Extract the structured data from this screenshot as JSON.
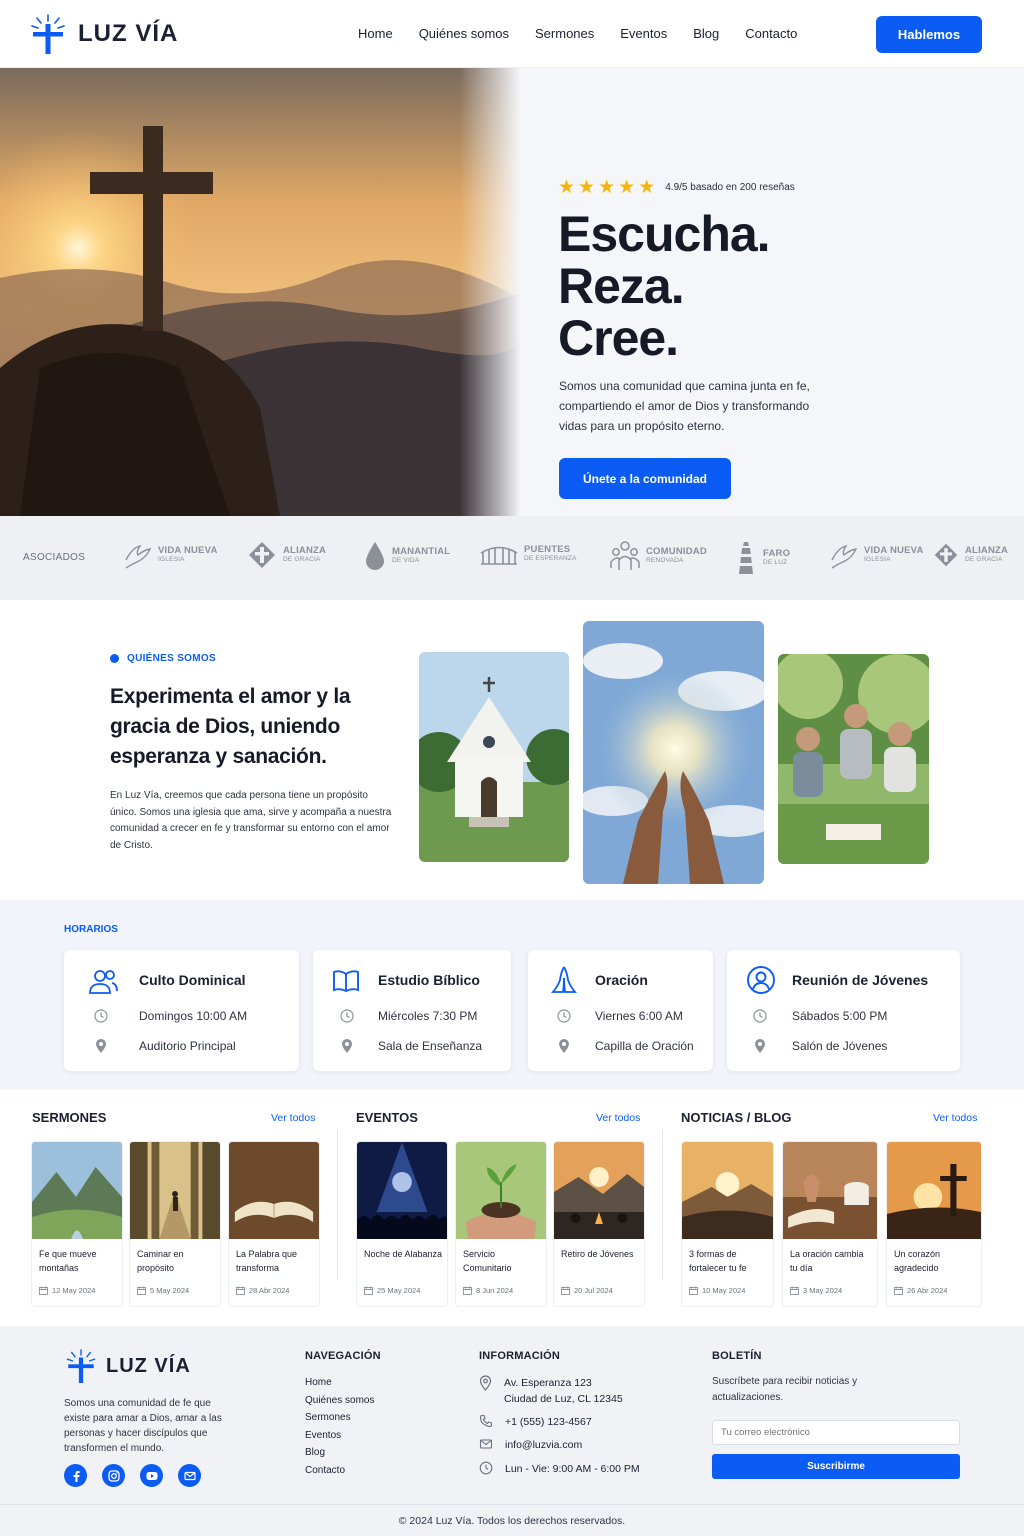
{
  "brand": {
    "name": "LUZ VÍA",
    "accent": "#0b5cf5"
  },
  "nav": {
    "items": [
      "Home",
      "Quiénes somos",
      "Sermones",
      "Eventos",
      "Blog",
      "Contacto"
    ],
    "cta": "Hablemos"
  },
  "hero": {
    "rating_stars": 5,
    "rating_text": "4.9/5 basado en 200 reseñas",
    "headline": [
      "Escucha.",
      "Reza.",
      "Cree."
    ],
    "text": "Somos una comunidad que camina junta en fe, compartiendo el amor de Dios y transformando vidas para un propósito eterno.",
    "cta": "Únete a la comunidad",
    "image_icon": "cross-on-mountain-sunset"
  },
  "partners": {
    "label": "ASOCIADOS",
    "items": [
      {
        "name": "VIDA NUEVA",
        "sub": "IGLESIA",
        "icon": "dove-icon"
      },
      {
        "name": "ALIANZA",
        "sub": "DE GRACIA",
        "icon": "cross-badge-icon"
      },
      {
        "name": "MANANTIAL",
        "sub": "DE VIDA",
        "icon": "drop-icon"
      },
      {
        "name": "PUENTES",
        "sub": "DE ESPERANZA",
        "icon": "bridge-icon"
      },
      {
        "name": "COMUNIDAD",
        "sub": "RENOVADA",
        "icon": "people-icon"
      },
      {
        "name": "FARO",
        "sub": "DE LUZ",
        "icon": "lighthouse-icon"
      },
      {
        "name": "VIDA NUEVA",
        "sub": "IGLESIA",
        "icon": "dove-icon"
      },
      {
        "name": "ALIANZA",
        "sub": "DE GRACIA",
        "icon": "cross-badge-icon"
      }
    ]
  },
  "about": {
    "kicker": "QUIÉNES SOMOS",
    "title": "Experimenta el amor y la gracia de Dios, uniendo esperanza y sanación.",
    "text": "En Luz Vía, creemos que cada persona tiene un propósito único. Somos una iglesia que ama, sirve y acompaña a nuestra comunidad a crecer en fe y transformar su entorno con el amor de Cristo."
  },
  "horarios": {
    "title": "HORARIOS",
    "cards": [
      {
        "title": "Culto Dominical",
        "time": "Domingos 10:00 AM",
        "place": "Auditorio Principal",
        "icon": "group-icon"
      },
      {
        "title": "Estudio Bíblico",
        "time": "Miércoles 7:30 PM",
        "place": "Sala de Enseñanza",
        "icon": "book-icon"
      },
      {
        "title": "Oración",
        "time": "Viernes 6:00 AM",
        "place": "Capilla de Oración",
        "icon": "praying-hands-icon"
      },
      {
        "title": "Reunión de Jóvenes",
        "time": "Sábados 5:00 PM",
        "place": "Salón de Jóvenes",
        "icon": "user-circle-icon"
      }
    ]
  },
  "sermones": {
    "title": "SERMONES",
    "link": "Ver todos",
    "items": [
      {
        "title": "Fe que mueve montañas",
        "date": "12 May 2024"
      },
      {
        "title": "Caminar en propósito",
        "date": "5 May 2024"
      },
      {
        "title": "La Palabra que transforma",
        "date": "28 Abr 2024"
      }
    ]
  },
  "eventos": {
    "title": "EVENTOS",
    "link": "Ver todos",
    "items": [
      {
        "title": "Noche de Alabanza",
        "date": "25 May 2024"
      },
      {
        "title": "Servicio Comunitario",
        "date": "8 Jun 2024"
      },
      {
        "title": "Retiro de Jóvenes",
        "date": "20 Jul 2024"
      }
    ]
  },
  "blog": {
    "title": "NOTICIAS / BLOG",
    "link": "Ver todos",
    "items": [
      {
        "title": "3 formas de fortalecer tu fe",
        "date": "10 May 2024"
      },
      {
        "title": "La oración cambia tu día",
        "date": "3 May 2024"
      },
      {
        "title": "Un corazón agradecido",
        "date": "26 Abr 2024"
      }
    ]
  },
  "footer": {
    "desc": "Somos una comunidad de fe que existe para amar a Dios, amar a las personas y hacer discípulos que transformen el mundo.",
    "social": [
      "facebook-icon",
      "instagram-icon",
      "youtube-icon",
      "mail-icon"
    ],
    "nav_title": "NAVEGACIÓN",
    "nav_items": [
      "Home",
      "Quiénes somos",
      "Sermones",
      "Eventos",
      "Blog",
      "Contacto"
    ],
    "info_title": "INFORMACIÓN",
    "address_line1": "Av. Esperanza 123",
    "address_line2": "Ciudad de Luz, CL 12345",
    "phone": "+1 (555) 123-4567",
    "email": "info@luzvia.com",
    "hours": "Lun - Vie: 9:00 AM - 6:00 PM",
    "newsletter_title": "BOLETÍN",
    "newsletter_text": "Suscríbete para recibir noticias y actualizaciones.",
    "newsletter_placeholder": "Tu correo electrónico",
    "newsletter_button": "Suscribirme",
    "copyright": "© 2024 Luz Vía. Todos los derechos reservados."
  }
}
